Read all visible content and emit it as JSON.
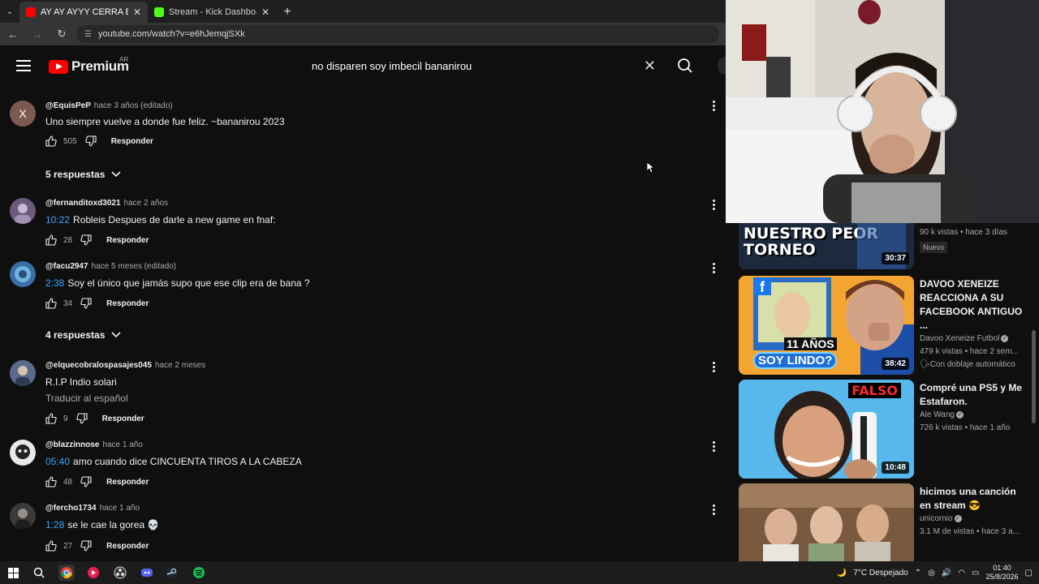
{
  "browser": {
    "tabs": [
      {
        "title": "AY AY AYYY CERRA EL C",
        "active": true,
        "favicon": "youtube-icon"
      },
      {
        "title": "Stream - Kick Dashboard",
        "active": false,
        "favicon": "kick-icon"
      }
    ],
    "url": "youtube.com/watch?v=e6hJemqjSXk"
  },
  "header": {
    "brand": "Premium",
    "region": "AR",
    "search_query": "no disparen soy imbecil bananirou"
  },
  "comments": [
    {
      "author": "@EquisPeP",
      "meta": "hace 3 años (editado)",
      "timestamp": "",
      "text": "Uno siempre vuelve a donde fue feliz.  ~bananirou 2023",
      "likes": "505",
      "reply": "Responder",
      "avatar_letter": "X",
      "avatar_color": "#7d5a50",
      "replies": "5 respuestas"
    },
    {
      "author": "@fernanditoxd3021",
      "meta": "hace 2 años",
      "timestamp": "10:22",
      "text": "Robleis Despues de darle a new game en fnaf:",
      "likes": "28",
      "reply": "Responder",
      "avatar_letter": "",
      "avatar_color": "#6b5a7a"
    },
    {
      "author": "@facu2947",
      "meta": "hace 5 meses (editado)",
      "timestamp": "2:38",
      "text": "Soy el único que jamás supo que ese clip era de bana ?",
      "likes": "34",
      "reply": "Responder",
      "avatar_letter": "",
      "avatar_color": "#3a6ea5",
      "replies": "4 respuestas"
    },
    {
      "author": "@elquecobralospasajes045",
      "meta": "hace 2 meses",
      "timestamp": "",
      "text": "R.I.P Indio solari",
      "translate": "Traducir al español",
      "likes": "9",
      "reply": "Responder",
      "avatar_letter": "",
      "avatar_color": "#5a6a8a"
    },
    {
      "author": "@blazzinnose",
      "meta": "hace 1 año",
      "timestamp": "05:40",
      "text": "amo cuando dice CINCUENTA TIROS A LA CABEZA",
      "likes": "48",
      "reply": "Responder",
      "avatar_letter": "",
      "avatar_color": "#e8e8e8"
    },
    {
      "author": "@fercho1734",
      "meta": "hace 1 año",
      "timestamp": "1:28",
      "text": "se le cae la gorea 💀",
      "likes": "27",
      "reply": "Responder",
      "avatar_letter": "",
      "avatar_color": "#3a3a3a"
    }
  ],
  "sidebar": [
    {
      "thumb_text": "NUESTRO PEOR TORNEO",
      "duration": "30:37",
      "title": "",
      "channel": "",
      "meta": "90 k vistas • hace 3 días",
      "badge": "Nuevo"
    },
    {
      "thumb_text": "11 AÑOS",
      "thumb_text2": "SOY LINDO?",
      "duration": "38:42",
      "title": "DAVOO XENEIZE REACCIONA A SU FACEBOOK ANTIGUO ...",
      "channel": "Davoo Xeneize Futbol",
      "meta": "479 k vistas • hace 2 sem...",
      "badge": "Con doblaje automático"
    },
    {
      "thumb_text": "FALSO",
      "duration": "10:48",
      "title": "Compré una PS5 y Me Estafaron.",
      "channel": "Ale Wang",
      "meta": "726 k vistas • hace 1 año",
      "badge": ""
    },
    {
      "thumb_text": "",
      "duration": "",
      "title": "hicimos una canción en stream 😎",
      "channel": "unicornio",
      "meta": "3.1 M de vistas • hace 3 a...",
      "badge": ""
    }
  ],
  "taskbar": {
    "weather": "7°C  Despejado",
    "time": "01:40",
    "date": "25/8/2026"
  },
  "colors": {
    "background": "#0f0f0f",
    "link_blue": "#3ea6ff",
    "youtube_red": "#ff0000"
  }
}
